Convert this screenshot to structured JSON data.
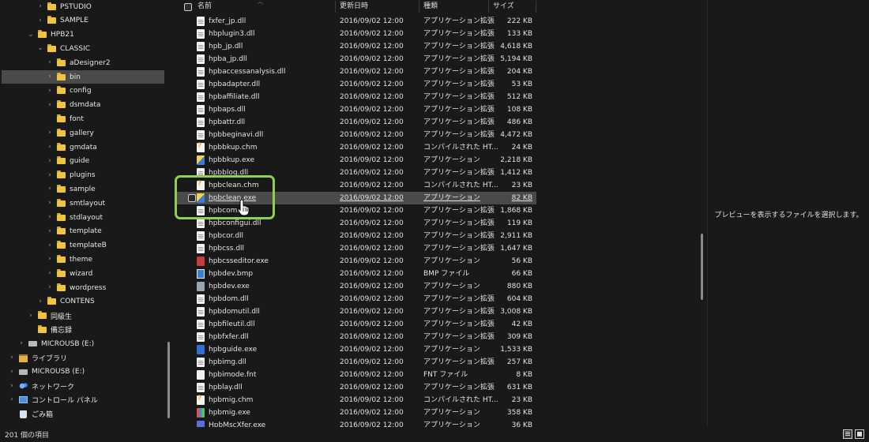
{
  "nav": {
    "items": [
      {
        "label": "PSTUDIO",
        "chev": "›",
        "icon": "folder-icon"
      },
      {
        "label": "SAMPLE",
        "chev": "›",
        "icon": "folder-icon"
      },
      {
        "label": "HPB21",
        "chev": "⌄",
        "icon": "folder-icon"
      },
      {
        "label": "CLASSIC",
        "chev": "⌄",
        "icon": "folder-icon"
      },
      {
        "label": "aDesigner2",
        "chev": "›",
        "icon": "folder-icon"
      },
      {
        "label": "bin",
        "chev": "›",
        "icon": "folder-icon",
        "selected": true
      },
      {
        "label": "config",
        "chev": "›",
        "icon": "folder-icon"
      },
      {
        "label": "dsmdata",
        "chev": "›",
        "icon": "folder-icon"
      },
      {
        "label": "font",
        "chev": "",
        "icon": "folder-icon"
      },
      {
        "label": "gallery",
        "chev": "›",
        "icon": "folder-icon"
      },
      {
        "label": "gmdata",
        "chev": "›",
        "icon": "folder-icon"
      },
      {
        "label": "guide",
        "chev": "›",
        "icon": "folder-icon"
      },
      {
        "label": "plugins",
        "chev": "›",
        "icon": "folder-icon"
      },
      {
        "label": "sample",
        "chev": "›",
        "icon": "folder-icon"
      },
      {
        "label": "smtlayout",
        "chev": "›",
        "icon": "folder-icon"
      },
      {
        "label": "stdlayout",
        "chev": "›",
        "icon": "folder-icon"
      },
      {
        "label": "template",
        "chev": "›",
        "icon": "folder-icon"
      },
      {
        "label": "templateB",
        "chev": "›",
        "icon": "folder-icon"
      },
      {
        "label": "theme",
        "chev": "›",
        "icon": "folder-icon"
      },
      {
        "label": "wizard",
        "chev": "›",
        "icon": "folder-icon"
      },
      {
        "label": "wordpress",
        "chev": "›",
        "icon": "folder-icon"
      },
      {
        "label": "CONTENS",
        "chev": "›",
        "icon": "folder-icon"
      },
      {
        "label": "同級生",
        "chev": "›",
        "icon": "folder-icon"
      },
      {
        "label": "備忘録",
        "chev": "",
        "icon": "folder-icon"
      },
      {
        "label": "MICROUSB (E:)",
        "chev": "›",
        "icon": "drive-icon"
      },
      {
        "label": "ライブラリ",
        "chev": "›",
        "icon": "library-icon"
      },
      {
        "label": "MICROUSB (E:)",
        "chev": "›",
        "icon": "drive-icon"
      },
      {
        "label": "ネットワーク",
        "chev": "›",
        "icon": "network-icon"
      },
      {
        "label": "コントロール パネル",
        "chev": "›",
        "icon": "control-panel-icon"
      },
      {
        "label": "ごみ箱",
        "chev": "",
        "icon": "recycle-bin-icon"
      }
    ]
  },
  "list": {
    "headers": {
      "name": "名前",
      "date": "更新日時",
      "type": "種類",
      "size": "サイズ"
    },
    "rows": [
      {
        "name": "fxfer_jp.dll",
        "date": "2016/09/02 12:00",
        "type": "アプリケーション拡張",
        "size": "222 KB",
        "icon": "dll"
      },
      {
        "name": "hbplugin3.dll",
        "date": "2016/09/02 12:00",
        "type": "アプリケーション拡張",
        "size": "133 KB",
        "icon": "dll"
      },
      {
        "name": "hpb_jp.dll",
        "date": "2016/09/02 12:00",
        "type": "アプリケーション拡張",
        "size": "4,618 KB",
        "icon": "dll"
      },
      {
        "name": "hpba_jp.dll",
        "date": "2016/09/02 12:00",
        "type": "アプリケーション拡張",
        "size": "5,194 KB",
        "icon": "dll"
      },
      {
        "name": "hpbaccessanalysis.dll",
        "date": "2016/09/02 12:00",
        "type": "アプリケーション拡張",
        "size": "204 KB",
        "icon": "dll"
      },
      {
        "name": "hpbadapter.dll",
        "date": "2016/09/02 12:00",
        "type": "アプリケーション拡張",
        "size": "53 KB",
        "icon": "dll"
      },
      {
        "name": "hpbaffiliate.dll",
        "date": "2016/09/02 12:00",
        "type": "アプリケーション拡張",
        "size": "512 KB",
        "icon": "dll"
      },
      {
        "name": "hpbaps.dll",
        "date": "2016/09/02 12:00",
        "type": "アプリケーション拡張",
        "size": "108 KB",
        "icon": "dll"
      },
      {
        "name": "hpbattr.dll",
        "date": "2016/09/02 12:00",
        "type": "アプリケーション拡張",
        "size": "486 KB",
        "icon": "dll"
      },
      {
        "name": "hpbbeginavi.dll",
        "date": "2016/09/02 12:00",
        "type": "アプリケーション拡張",
        "size": "4,472 KB",
        "icon": "dll"
      },
      {
        "name": "hpbbkup.chm",
        "date": "2016/09/02 12:00",
        "type": "コンパイルされた HT...",
        "size": "24 KB",
        "icon": "chm"
      },
      {
        "name": "hpbbkup.exe",
        "date": "2016/09/02 12:00",
        "type": "アプリケーション",
        "size": "2,218 KB",
        "icon": "exe-y"
      },
      {
        "name": "hpbblog.dll",
        "date": "2016/09/02 12:00",
        "type": "アプリケーション拡張",
        "size": "1,412 KB",
        "icon": "dll"
      },
      {
        "name": "hpbclean.chm",
        "date": "2016/09/02 12:00",
        "type": "コンパイルされた HT...",
        "size": "23 KB",
        "icon": "chm"
      },
      {
        "name": "hpbclean.exe",
        "date": "2016/09/02 12:00",
        "type": "アプリケーション",
        "size": "82 KB",
        "icon": "exe-y",
        "hover": true
      },
      {
        "name": "hpbcom.dll",
        "date": "2016/09/02 12:00",
        "type": "アプリケーション拡張",
        "size": "1,868 KB",
        "icon": "dll"
      },
      {
        "name": "hpbconfigui.dll",
        "date": "2016/09/02 12:00",
        "type": "アプリケーション拡張",
        "size": "119 KB",
        "icon": "dll"
      },
      {
        "name": "hpbcor.dll",
        "date": "2016/09/02 12:00",
        "type": "アプリケーション拡張",
        "size": "2,911 KB",
        "icon": "dll"
      },
      {
        "name": "hpbcss.dll",
        "date": "2016/09/02 12:00",
        "type": "アプリケーション拡張",
        "size": "1,647 KB",
        "icon": "dll"
      },
      {
        "name": "hpbcsseditor.exe",
        "date": "2016/09/02 12:00",
        "type": "アプリケーション",
        "size": "56 KB",
        "icon": "exe-r"
      },
      {
        "name": "hpbdev.bmp",
        "date": "2016/09/02 12:00",
        "type": "BMP ファイル",
        "size": "66 KB",
        "icon": "bmp"
      },
      {
        "name": "hpbdev.exe",
        "date": "2016/09/02 12:00",
        "type": "アプリケーション",
        "size": "880 KB",
        "icon": "exe-dev"
      },
      {
        "name": "hpbdom.dll",
        "date": "2016/09/02 12:00",
        "type": "アプリケーション拡張",
        "size": "604 KB",
        "icon": "dll"
      },
      {
        "name": "hpbdomutil.dll",
        "date": "2016/09/02 12:00",
        "type": "アプリケーション拡張",
        "size": "3,008 KB",
        "icon": "dll"
      },
      {
        "name": "hpbfileutil.dll",
        "date": "2016/09/02 12:00",
        "type": "アプリケーション拡張",
        "size": "42 KB",
        "icon": "dll"
      },
      {
        "name": "hpbfxfer.dll",
        "date": "2016/09/02 12:00",
        "type": "アプリケーション拡張",
        "size": "309 KB",
        "icon": "dll"
      },
      {
        "name": "hpbguide.exe",
        "date": "2016/09/02 12:00",
        "type": "アプリケーション",
        "size": "1,533 KB",
        "icon": "exe"
      },
      {
        "name": "hpbimg.dll",
        "date": "2016/09/02 12:00",
        "type": "アプリケーション拡張",
        "size": "257 KB",
        "icon": "dll"
      },
      {
        "name": "hpbimode.fnt",
        "date": "2016/09/02 12:00",
        "type": "FNT ファイル",
        "size": "8 KB",
        "icon": "fnt"
      },
      {
        "name": "hpblay.dll",
        "date": "2016/09/02 12:00",
        "type": "アプリケーション拡張",
        "size": "631 KB",
        "icon": "dll"
      },
      {
        "name": "hpbmig.chm",
        "date": "2016/09/02 12:00",
        "type": "コンパイルされた HT...",
        "size": "23 KB",
        "icon": "chm"
      },
      {
        "name": "hpbmig.exe",
        "date": "2016/09/02 12:00",
        "type": "アプリケーション",
        "size": "358 KB",
        "icon": "exe-m"
      },
      {
        "name": "HpbMscXfer.exe",
        "date": "2016/09/02 12:00",
        "type": "アプリケーション",
        "size": "36 KB",
        "icon": "exe-g"
      }
    ]
  },
  "preview": {
    "message": "プレビューを表示するファイルを選択します。"
  },
  "status": {
    "count": "201 個の項目"
  },
  "colors": {
    "background": "#191919",
    "selection": "#4a4a4a",
    "folder": "#f0c341",
    "highlight": "#8fd14f"
  }
}
